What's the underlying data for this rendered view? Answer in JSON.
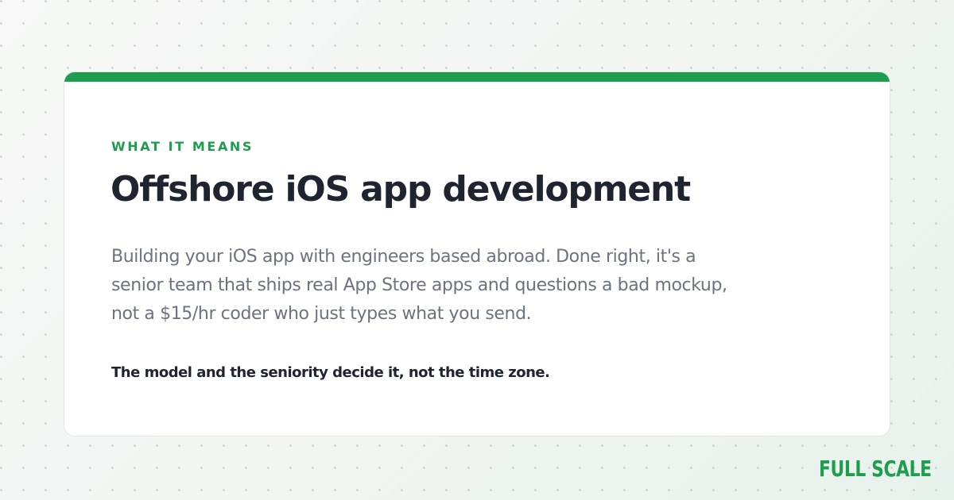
{
  "card": {
    "eyebrow": "WHAT IT MEANS",
    "title": "Offshore iOS app development",
    "description": "Building your iOS app with engineers based abroad. Done right, it's a senior team that ships real App Store apps and questions a bad mockup, not a $15/hr coder who just types what you send.",
    "footnote": "The model and the seniority decide it, not the time zone."
  },
  "brand": {
    "logo_text": "FULL SCALE"
  },
  "colors": {
    "accent": "#1f9d4f",
    "heading": "#1e2430",
    "body_text": "#6b7280",
    "card_background": "#ffffff",
    "page_background": "#f3f6f4"
  }
}
